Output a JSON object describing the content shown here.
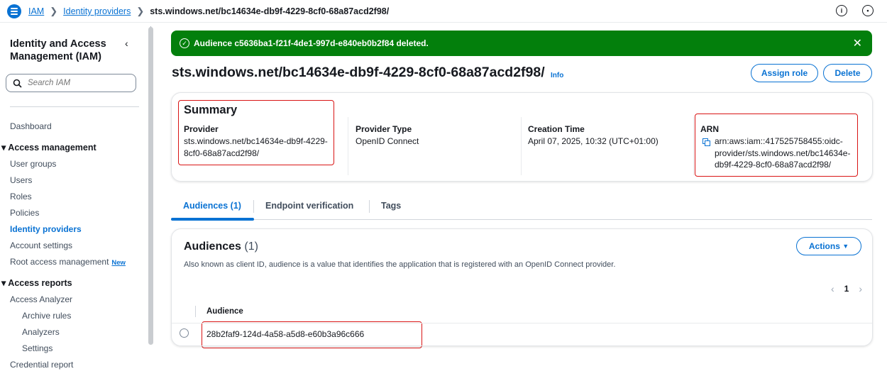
{
  "breadcrumb": {
    "items": [
      "IAM",
      "Identity providers"
    ],
    "current": "sts.windows.net/bc14634e-db9f-4229-8cf0-68a87acd2f98/"
  },
  "sidebar": {
    "title": "Identity and Access Management (IAM)",
    "search_placeholder": "Search IAM",
    "dashboard": "Dashboard",
    "access_management": {
      "label": "Access management",
      "items": [
        "User groups",
        "Users",
        "Roles",
        "Policies",
        "Identity providers",
        "Account settings",
        "Root access management"
      ],
      "active": "Identity providers",
      "new_badge": "New"
    },
    "access_reports": {
      "label": "Access reports",
      "items": [
        "Access Analyzer",
        "Archive rules",
        "Analyzers",
        "Settings",
        "Credential report"
      ]
    }
  },
  "flash": {
    "message": "Audience c5636ba1-f21f-4de1-997d-e840eb0b2f84 deleted.",
    "color": "#037f0c"
  },
  "page": {
    "title": "sts.windows.net/bc14634e-db9f-4229-8cf0-68a87acd2f98/",
    "info": "Info",
    "assign_role": "Assign role",
    "delete": "Delete"
  },
  "summary": {
    "heading": "Summary",
    "provider_label": "Provider",
    "provider_value_line1": "sts.windows.net/bc14634e-db9f-4229-",
    "provider_value_line2": "8cf0-68a87acd2f98/",
    "type_label": "Provider Type",
    "type_value": "OpenID Connect",
    "created_label": "Creation Time",
    "created_value": "April 07, 2025, 10:32 (UTC+01:00)",
    "arn_label": "ARN",
    "arn_line1": "arn:aws:iam::417525758455:oidc-",
    "arn_line2": "provider/sts.windows.net/bc14634e-",
    "arn_line3": "db9f-4229-8cf0-68a87acd2f98/"
  },
  "tabs": [
    "Audiences (1)",
    "Endpoint verification",
    "Tags"
  ],
  "audiences": {
    "heading": "Audiences",
    "count": "(1)",
    "description": "Also known as client ID, audience is a value that identifies the application that is registered with an OpenID Connect provider.",
    "actions": "Actions",
    "page": "1",
    "column": "Audience",
    "rows": [
      "28b2faf9-124d-4a58-a5d8-e60b3a96c666"
    ]
  },
  "colors": {
    "accent": "#0972d3",
    "highlight": "#d91515",
    "success": "#037f0c"
  }
}
